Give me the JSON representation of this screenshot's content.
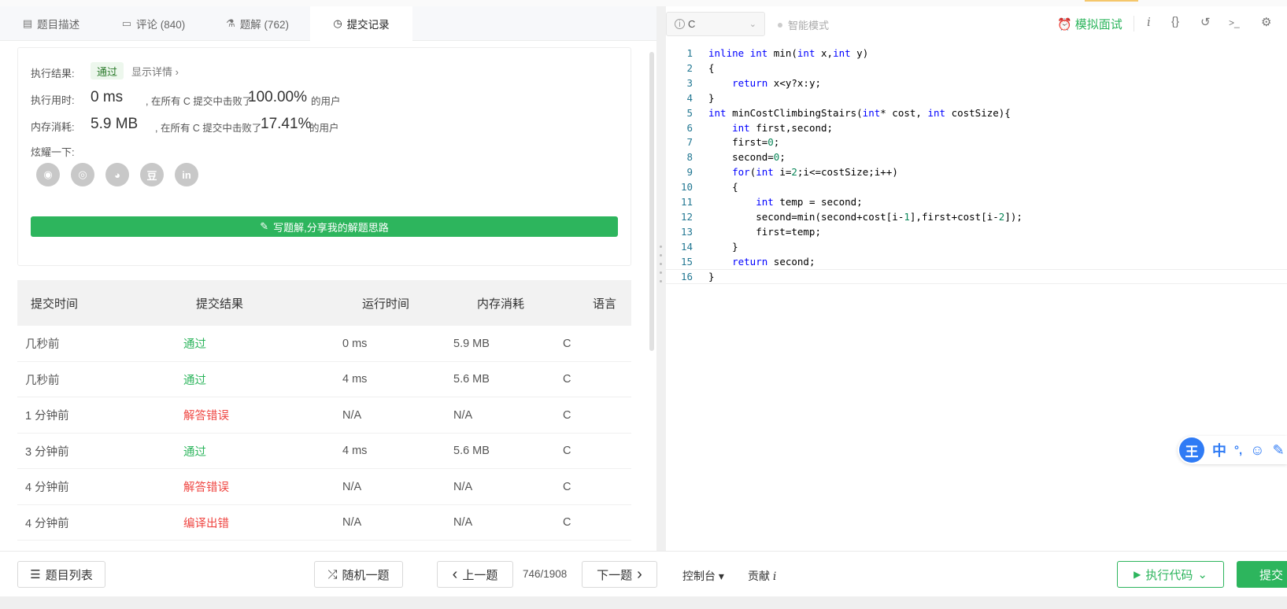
{
  "tabs": [
    {
      "icon": "description-icon",
      "glyph": "▤",
      "label": "题目描述"
    },
    {
      "icon": "comment-icon",
      "glyph": "▭",
      "label": "评论 (840)"
    },
    {
      "icon": "flask-icon",
      "glyph": "⚗",
      "label": "题解 (762)"
    },
    {
      "icon": "clock-icon",
      "glyph": "◷",
      "label": "提交记录"
    }
  ],
  "result": {
    "label_result": "执行结果:",
    "status": "通过",
    "details": "显示详情 ›",
    "label_time": "执行用时:",
    "time_value": "0 ms",
    "time_mid": ", 在所有 C 提交中击败了",
    "time_percent": "100.00%",
    "users_suffix": "的用户",
    "label_mem": "内存消耗:",
    "mem_value": "5.9 MB",
    "mem_mid": ", 在所有 C 提交中击败了",
    "mem_percent": "17.41%",
    "share_label": "炫耀一下:",
    "share_icons": [
      {
        "name": "wechat-icon",
        "glyph": "◉"
      },
      {
        "name": "weibo-icon",
        "glyph": "◎"
      },
      {
        "name": "qq-icon",
        "glyph": "◕"
      },
      {
        "name": "douban-icon",
        "glyph": "豆"
      },
      {
        "name": "linkedin-icon",
        "glyph": "in"
      }
    ],
    "write_solution": "写题解,分享我的解题思路",
    "pencil_glyph": "✎"
  },
  "table": {
    "headers": [
      "提交时间",
      "提交结果",
      "运行时间",
      "内存消耗",
      "语言"
    ],
    "rows": [
      {
        "time": "几秒前",
        "result": "通过",
        "status": "ok",
        "runtime": "0 ms",
        "memory": "5.9 MB",
        "lang": "C"
      },
      {
        "time": "几秒前",
        "result": "通过",
        "status": "ok",
        "runtime": "4 ms",
        "memory": "5.6 MB",
        "lang": "C"
      },
      {
        "time": "1 分钟前",
        "result": "解答错误",
        "status": "err",
        "runtime": "N/A",
        "memory": "N/A",
        "lang": "C"
      },
      {
        "time": "3 分钟前",
        "result": "通过",
        "status": "ok",
        "runtime": "4 ms",
        "memory": "5.6 MB",
        "lang": "C"
      },
      {
        "time": "4 分钟前",
        "result": "解答错误",
        "status": "err",
        "runtime": "N/A",
        "memory": "N/A",
        "lang": "C"
      },
      {
        "time": "4 分钟前",
        "result": "编译出错",
        "status": "err",
        "runtime": "N/A",
        "memory": "N/A",
        "lang": "C"
      }
    ]
  },
  "toolbar": {
    "language": "C",
    "smart_mode": "智能模式",
    "mock_interview": "模拟面试",
    "alarm_glyph": "⏰",
    "icons": [
      {
        "name": "info-icon",
        "glyph": "i"
      },
      {
        "name": "braces-icon",
        "glyph": "{}"
      },
      {
        "name": "reset-icon",
        "glyph": "↺"
      },
      {
        "name": "terminal-icon",
        "glyph": ">_"
      },
      {
        "name": "settings-icon",
        "glyph": "⚙"
      }
    ]
  },
  "code_lines": [
    {
      "n": "1",
      "html": "<span class='kw'>inline</span> <span class='kw'>int</span> min(<span class='kw'>int</span> x,<span class='kw'>int</span> y)"
    },
    {
      "n": "2",
      "html": "{"
    },
    {
      "n": "3",
      "html": "    <span class='kw'>return</span> x&lt;y?x:y;"
    },
    {
      "n": "4",
      "html": "}"
    },
    {
      "n": "5",
      "html": "<span class='kw'>int</span> minCostClimbingStairs(<span class='kw'>int</span>* cost, <span class='kw'>int</span> costSize){"
    },
    {
      "n": "6",
      "html": "    <span class='kw'>int</span> first,second;"
    },
    {
      "n": "7",
      "html": "    first=<span class='num'>0</span>;"
    },
    {
      "n": "8",
      "html": "    second=<span class='num'>0</span>;"
    },
    {
      "n": "9",
      "html": "    <span class='kw'>for</span>(<span class='kw'>int</span> i=<span class='num'>2</span>;i&lt;=costSize;i++)"
    },
    {
      "n": "10",
      "html": "    {"
    },
    {
      "n": "11",
      "html": "        <span class='kw'>int</span> temp = second;"
    },
    {
      "n": "12",
      "html": "        second=min(second+cost[i-<span class='num'>1</span>],first+cost[i-<span class='num'>2</span>]);"
    },
    {
      "n": "13",
      "html": "        first=temp;"
    },
    {
      "n": "14",
      "html": "    }"
    },
    {
      "n": "15",
      "html": "    <span class='kw'>return</span> second;"
    },
    {
      "n": "16",
      "html": "}"
    }
  ],
  "ime": {
    "logo": "王",
    "items": [
      {
        "name": "ime-chinese-icon",
        "glyph": "中"
      },
      {
        "name": "ime-punct-icon",
        "glyph": "°,"
      },
      {
        "name": "ime-emoji-icon",
        "glyph": "☺"
      },
      {
        "name": "ime-pen-icon",
        "glyph": "✎"
      }
    ]
  },
  "bottom": {
    "problem_list": "题目列表",
    "list_glyph": "☰",
    "random": "随机一题",
    "shuffle_glyph": "⤮",
    "prev": "上一题",
    "prev_glyph": "‹",
    "pager": "746/1908",
    "next": "下一题",
    "next_glyph": "›",
    "console": "控制台 ▾",
    "contribute": "贡献",
    "contribute_i": "i",
    "run_code": "执行代码",
    "play_glyph": "▶",
    "run_chev": "⌄",
    "submit": "提交"
  }
}
